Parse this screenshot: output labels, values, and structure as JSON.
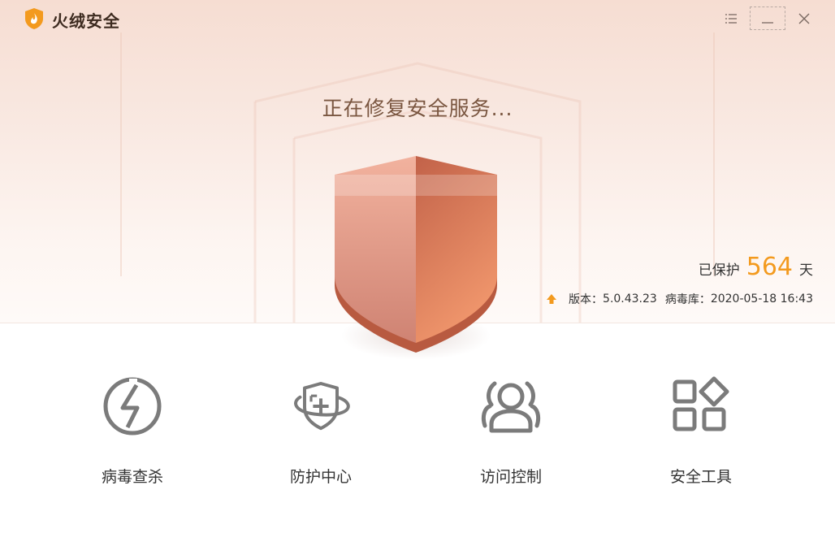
{
  "app": {
    "name": "火绒安全"
  },
  "titlebar": {
    "menu_icon": "menu-icon",
    "minimize_icon": "minimize-icon",
    "close_icon": "close-icon"
  },
  "status": {
    "title": "正在修复安全服务..."
  },
  "protection": {
    "prefix": "已保护",
    "days": "564",
    "suffix": "天"
  },
  "version_info": {
    "version_label": "版本：",
    "version": "5.0.43.23",
    "db_label": "病毒库：",
    "db_date": "2020-05-18 16:43"
  },
  "nav": [
    {
      "label": "病毒查杀",
      "icon": "lightning-circle-icon"
    },
    {
      "label": "防护中心",
      "icon": "shield-plus-icon"
    },
    {
      "label": "访问控制",
      "icon": "users-icon"
    },
    {
      "label": "安全工具",
      "icon": "apps-icon"
    }
  ],
  "colors": {
    "accent": "#f39a1e",
    "shield_light": "#e9a08e",
    "shield_dark": "#c9694c",
    "icon_gray": "#7b7b7b"
  }
}
